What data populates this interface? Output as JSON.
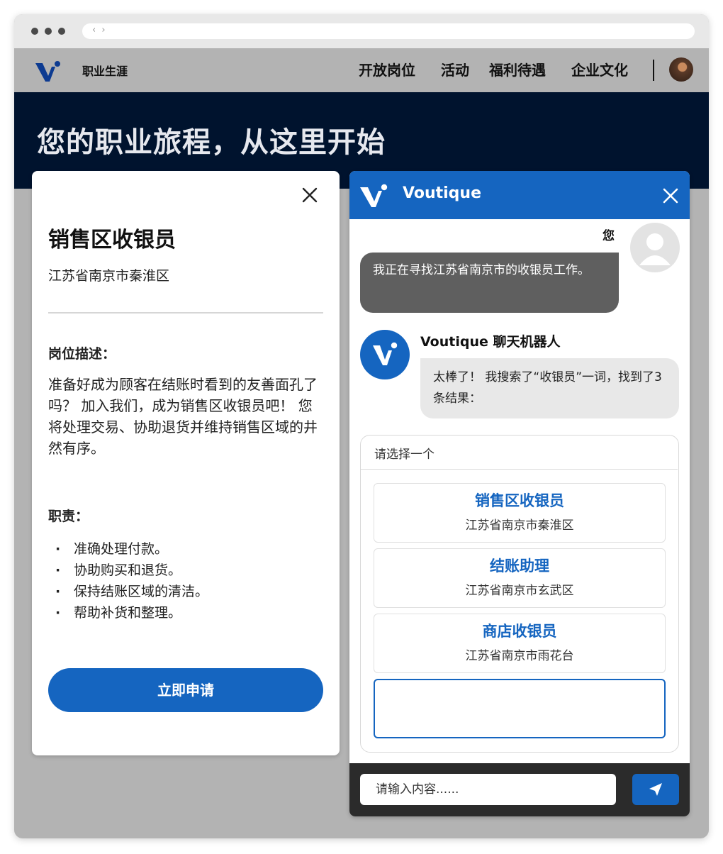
{
  "header": {
    "careers_label": "职业生涯",
    "nav_links": [
      "开放岗位",
      "活动",
      "福利待遇",
      "企业文化"
    ]
  },
  "hero": {
    "title": "您的职业旅程，从这里开始"
  },
  "job": {
    "title": "销售区收银员",
    "location": "江苏省南京市秦淮区",
    "desc_heading": "岗位描述：",
    "description": "准备好成为顾客在结账时看到的友善面孔了吗？ 加入我们，成为销售区收银员吧！ 您将处理交易、协助退货并维持销售区域的井然有序。",
    "duties_heading": "职责：",
    "duties": [
      "准确处理付款。",
      "协助购买和退货。",
      "保持结账区域的清洁。",
      "帮助补货和整理。"
    ],
    "apply_label": "立即申请"
  },
  "chat": {
    "brand": "Voutique",
    "user_label": "您",
    "user_message": "我正在寻找江苏省南京市的收银员工作。",
    "bot_name": "Voutique 聊天机器人",
    "bot_message": "太棒了！ 我搜索了“收银员”一词，找到了3条结果：",
    "select_prompt": "请选择一个",
    "options": [
      {
        "title": "销售区收银员",
        "location": "江苏省南京市秦淮区"
      },
      {
        "title": "结账助理",
        "location": "江苏省南京市玄武区"
      },
      {
        "title": "商店收银员",
        "location": "江苏省南京市雨花台"
      }
    ],
    "input_placeholder": "请输入内容......"
  },
  "colors": {
    "brand_blue": "#1565c0",
    "hero_navy": "#00132e",
    "user_bubble": "#5f5f5f",
    "bot_bubble": "#e8e8e8"
  },
  "icons": [
    "logo-icon",
    "close-icon",
    "user-avatar-icon",
    "send-icon"
  ]
}
